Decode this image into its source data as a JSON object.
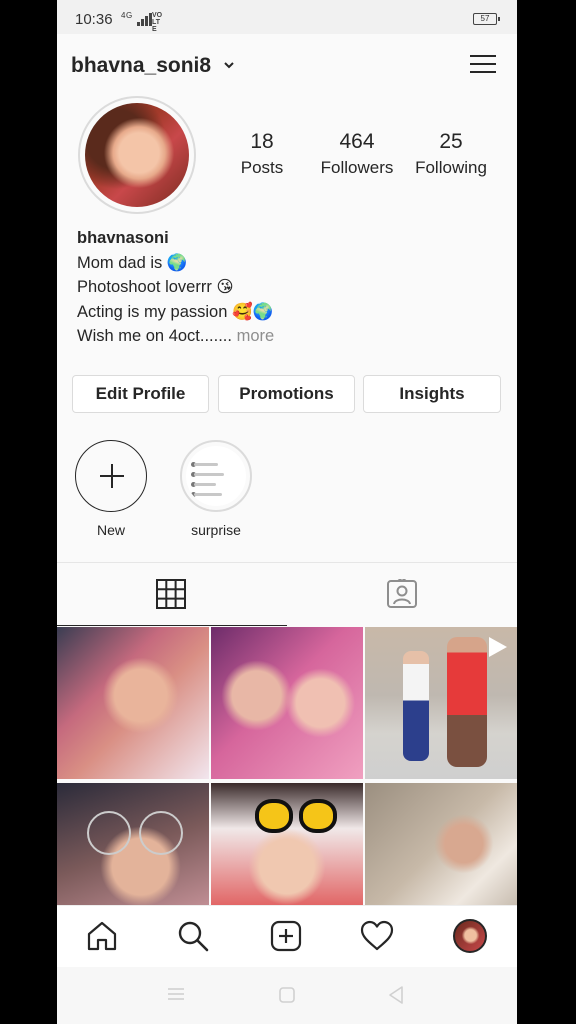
{
  "status_bar": {
    "time": "10:36",
    "network": "4G",
    "volte": "VO LTE",
    "battery": "57"
  },
  "header": {
    "username": "bhavna_soni8"
  },
  "profile": {
    "stats": [
      {
        "num": "18",
        "label": "Posts"
      },
      {
        "num": "464",
        "label": "Followers"
      },
      {
        "num": "25",
        "label": "Following"
      }
    ],
    "bio": {
      "name": "bhavnasoni",
      "line1": "Mom dad is 🌍",
      "line2": "Photoshoot loverrr 😘",
      "line3": "Acting is my passion 🥰🌍",
      "line4": "Wish me on 4oct.......",
      "more": "more"
    }
  },
  "buttons": {
    "edit_profile": "Edit Profile",
    "promotions": "Promotions",
    "insights": "Insights"
  },
  "highlights": [
    {
      "label": "New"
    },
    {
      "label": "surprise"
    }
  ],
  "tabs": [
    {
      "icon": "grid-icon",
      "active": true
    },
    {
      "icon": "tagged-icon",
      "active": false
    }
  ],
  "bottom_nav": [
    "home-icon",
    "search-icon",
    "add-post-icon",
    "activity-heart-icon",
    "profile-avatar"
  ],
  "colors": {
    "text": "#262626",
    "secondary": "#8e8e8e",
    "border": "#dbdbdb",
    "background": "#fafafa"
  }
}
